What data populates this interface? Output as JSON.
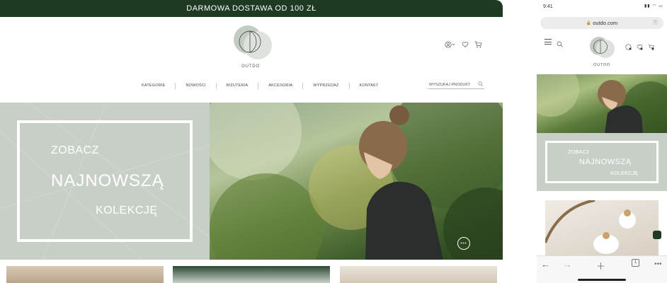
{
  "desktop": {
    "promo": {
      "text": "DARMOWA DOSTAWA OD 100 ZŁ"
    },
    "brand": {
      "name": "OUTDO"
    },
    "nav": [
      "KATEGORIE",
      "NOWOŚCI",
      "BIŻUTERIA",
      "AKCESORIA",
      "WYPRZEDAŻ",
      "KONTAKT"
    ],
    "search": {
      "placeholder": "WYSZUKAJ PRODUKT"
    },
    "hero": {
      "line1": "ZOBACZ",
      "line2": "NAJNOWSZĄ",
      "line3": "KOLEKCJĘ"
    },
    "icons": [
      "user-icon",
      "heart-icon",
      "cart-icon"
    ]
  },
  "mobile": {
    "status": {
      "time": "9:41"
    },
    "url": "outdo.com",
    "brand": {
      "name": "OUTDO"
    },
    "hero": {
      "line1": "ZOBACZ",
      "line2": "NAJNOWSZĄ",
      "line3": "KOLEKCJĘ"
    },
    "toolbar": {
      "tabs_count": "1"
    }
  },
  "colors": {
    "brand_green": "#1e3a23",
    "sage": "#c7cfc7",
    "logo_circle": "#c3ccc2"
  }
}
